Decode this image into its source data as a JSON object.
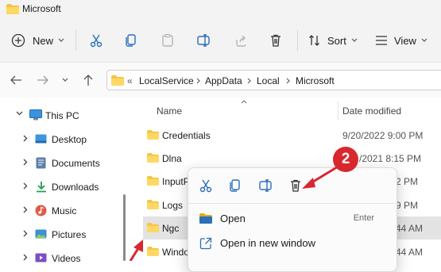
{
  "window": {
    "title": "Microsoft"
  },
  "toolbar": {
    "new_label": "New",
    "sort_label": "Sort",
    "view_label": "View"
  },
  "address": {
    "overflow": "«",
    "crumbs": [
      "LocalService",
      "AppData",
      "Local",
      "Microsoft"
    ]
  },
  "sidebar": {
    "items": [
      {
        "label": "This PC",
        "icon": "monitor-icon"
      },
      {
        "label": "Desktop",
        "icon": "desktop-icon"
      },
      {
        "label": "Documents",
        "icon": "documents-icon"
      },
      {
        "label": "Downloads",
        "icon": "download-icon"
      },
      {
        "label": "Music",
        "icon": "music-icon"
      },
      {
        "label": "Pictures",
        "icon": "pictures-icon"
      },
      {
        "label": "Videos",
        "icon": "videos-icon"
      }
    ]
  },
  "columns": {
    "name": "Name",
    "date": "Date modified"
  },
  "files": [
    {
      "name": "Credentials",
      "date": "9/20/2022 9:00 PM"
    },
    {
      "name": "Dlna",
      "date": "/2021 8:15 PM"
    },
    {
      "name": "InputP",
      "date": "2 PM"
    },
    {
      "name": "Logs",
      "date": "9 PM"
    },
    {
      "name": "Ngc",
      "date": "44 AM"
    },
    {
      "name": "Windo",
      "date": "44 AM"
    }
  ],
  "context_menu": {
    "items": [
      {
        "label": "Open",
        "shortcut": "Enter"
      },
      {
        "label": "Open in new window",
        "shortcut": ""
      }
    ]
  },
  "annotation": {
    "step": "2",
    "color": "#d9272e"
  }
}
